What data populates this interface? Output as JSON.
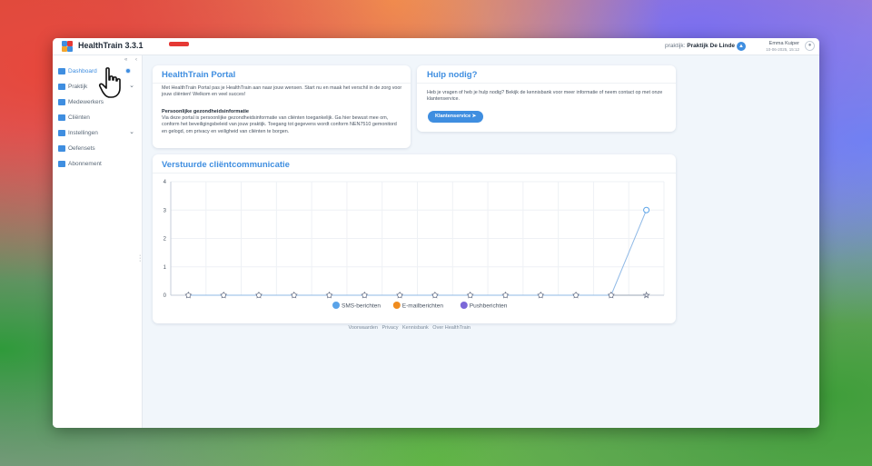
{
  "app": {
    "title": "HealthTrain 3.3.1",
    "env_badge": "",
    "practice_prefix": "praktijk:",
    "practice_name": "Praktijk De Linde",
    "user_name": "Emma Kuiper",
    "user_date": "10-06-2025, 15:12"
  },
  "sidebar": {
    "items": [
      {
        "label": "Dashboard",
        "icon": "dashboard-icon"
      },
      {
        "label": "Praktijk",
        "icon": "practice-icon"
      },
      {
        "label": "Medewerkers",
        "icon": "staff-icon"
      },
      {
        "label": "Cliënten",
        "icon": "clients-icon"
      },
      {
        "label": "Instellingen",
        "icon": "settings-icon"
      },
      {
        "label": "Oefensets",
        "icon": "folder-icon"
      },
      {
        "label": "Abonnement",
        "icon": "subscription-icon"
      }
    ]
  },
  "portal_card": {
    "title": "HealthTrain Portal",
    "intro": "Met HealthTrain Portal pas je HealthTrain aan naar jouw wensen. Start nu en maak het verschil in de zorg voor jouw cliënten! Welkom en veel succes!",
    "subheading": "Persoonlijke gezondheidsinformatie",
    "body": "Via deze portal is persoonlijke gezondheidsinformatie van cliënten toegankelijk. Ga hier bewust mee om, conform het beveiligingsbeleid van jouw praktijk. Toegang tot gegevens wordt conform NEN7510 gemonitord en gelogd, om privacy en veiligheid van cliënten te borgen."
  },
  "help_card": {
    "title": "Hulp nodig?",
    "body": "Heb je vragen of heb je hulp nodig? Bekijk de kennisbank voor meer informatie of neem contact op met onze klantenservice.",
    "button": "Klantenservice"
  },
  "chart_card": {
    "title": "Verstuurde cliëntcommunicatie"
  },
  "chart_data": {
    "type": "line",
    "title": "Verstuurde cliëntcommunicatie",
    "ylim": [
      0,
      4
    ],
    "yticks": [
      "0",
      "1",
      "2",
      "3",
      "4"
    ],
    "x": [
      1,
      2,
      3,
      4,
      5,
      6,
      7,
      8,
      9,
      10,
      11,
      12,
      13,
      14
    ],
    "grid": true,
    "legend_position": "bottom",
    "series": [
      {
        "name": "SMS-berichten",
        "color": "#5aa3e8",
        "values": [
          0,
          0,
          0,
          0,
          0,
          0,
          0,
          0,
          0,
          0,
          0,
          0,
          0,
          3
        ]
      },
      {
        "name": "E-mailberichten",
        "color": "#ef8c1f",
        "values": [
          0,
          0,
          0,
          0,
          0,
          0,
          0,
          0,
          0,
          0,
          0,
          0,
          0,
          0
        ]
      },
      {
        "name": "Pushberichten",
        "color": "#7b68d8",
        "values": [
          0,
          0,
          0,
          0,
          0,
          0,
          0,
          0,
          0,
          0,
          0,
          0,
          0,
          0
        ]
      }
    ]
  },
  "footer": {
    "links": [
      "Voorwaarden",
      "Privacy",
      "Kennisbank",
      "Over HealthTrain"
    ]
  }
}
